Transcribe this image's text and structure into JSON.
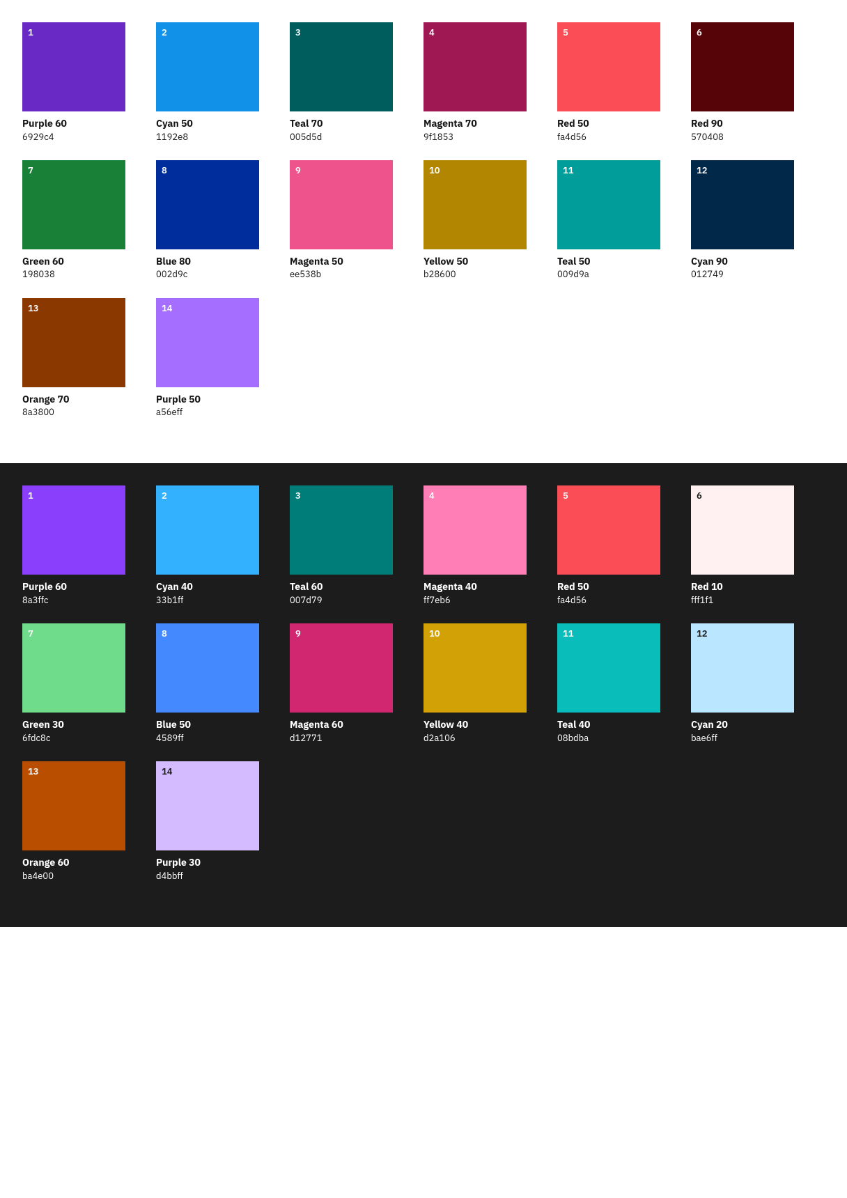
{
  "light": {
    "section": "light",
    "items": [
      {
        "number": "1",
        "name": "Purple 60",
        "hex": "6929c4",
        "color": "#6929c4",
        "textColor": "#fff"
      },
      {
        "number": "2",
        "name": "Cyan 50",
        "hex": "1192e8",
        "color": "#1192e8",
        "textColor": "#fff"
      },
      {
        "number": "3",
        "name": "Teal 70",
        "hex": "005d5d",
        "color": "#005d5d",
        "textColor": "#fff"
      },
      {
        "number": "4",
        "name": "Magenta 70",
        "hex": "9f1853",
        "color": "#9f1853",
        "textColor": "#fff"
      },
      {
        "number": "5",
        "name": "Red 50",
        "hex": "fa4d56",
        "color": "#fa4d56",
        "textColor": "#fff"
      },
      {
        "number": "6",
        "name": "Red 90",
        "hex": "570408",
        "color": "#570408",
        "textColor": "#fff"
      },
      {
        "number": "7",
        "name": "Green 60",
        "hex": "198038",
        "color": "#198038",
        "textColor": "#fff"
      },
      {
        "number": "8",
        "name": "Blue 80",
        "hex": "002d9c",
        "color": "#002d9c",
        "textColor": "#fff"
      },
      {
        "number": "9",
        "name": "Magenta 50",
        "hex": "ee538b",
        "color": "#ee538b",
        "textColor": "#fff"
      },
      {
        "number": "10",
        "name": "Yellow 50",
        "hex": "b28600",
        "color": "#b28600",
        "textColor": "#fff"
      },
      {
        "number": "11",
        "name": "Teal 50",
        "hex": "009d9a",
        "color": "#009d9a",
        "textColor": "#fff"
      },
      {
        "number": "12",
        "name": "Cyan 90",
        "hex": "012749",
        "color": "#012749",
        "textColor": "#fff"
      },
      {
        "number": "13",
        "name": "Orange 70",
        "hex": "8a3800",
        "color": "#8a3800",
        "textColor": "#fff"
      },
      {
        "number": "14",
        "name": "Purple 50",
        "hex": "a56eff",
        "color": "#a56eff",
        "textColor": "#fff"
      }
    ]
  },
  "dark": {
    "section": "dark",
    "items": [
      {
        "number": "1",
        "name": "Purple 60",
        "hex": "8a3ffc",
        "color": "#8a3ffc",
        "textColor": "#fff"
      },
      {
        "number": "2",
        "name": "Cyan 40",
        "hex": "33b1ff",
        "color": "#33b1ff",
        "textColor": "#fff"
      },
      {
        "number": "3",
        "name": "Teal 60",
        "hex": "007d79",
        "color": "#007d79",
        "textColor": "#fff"
      },
      {
        "number": "4",
        "name": "Magenta 40",
        "hex": "ff7eb6",
        "color": "#ff7eb6",
        "textColor": "#fff"
      },
      {
        "number": "5",
        "name": "Red 50",
        "hex": "fa4d56",
        "color": "#fa4d56",
        "textColor": "#fff"
      },
      {
        "number": "6",
        "name": "Red 10",
        "hex": "fff1f1",
        "color": "#fff1f1",
        "textColor": "#161616"
      },
      {
        "number": "7",
        "name": "Green 30",
        "hex": "6fdc8c",
        "color": "#6fdc8c",
        "textColor": "#fff"
      },
      {
        "number": "8",
        "name": "Blue 50",
        "hex": "4589ff",
        "color": "#4589ff",
        "textColor": "#fff"
      },
      {
        "number": "9",
        "name": "Magenta 60",
        "hex": "d12771",
        "color": "#d12771",
        "textColor": "#fff"
      },
      {
        "number": "10",
        "name": "Yellow 40",
        "hex": "d2a106",
        "color": "#d2a106",
        "textColor": "#fff"
      },
      {
        "number": "11",
        "name": "Teal 40",
        "hex": "08bdba",
        "color": "#08bdba",
        "textColor": "#fff"
      },
      {
        "number": "12",
        "name": "Cyan 20",
        "hex": "bae6ff",
        "color": "#bae6ff",
        "textColor": "#161616"
      },
      {
        "number": "13",
        "name": "Orange 60",
        "hex": "ba4e00",
        "color": "#ba4e00",
        "textColor": "#fff"
      },
      {
        "number": "14",
        "name": "Purple 30",
        "hex": "d4bbff",
        "color": "#d4bbff",
        "textColor": "#161616"
      }
    ]
  }
}
